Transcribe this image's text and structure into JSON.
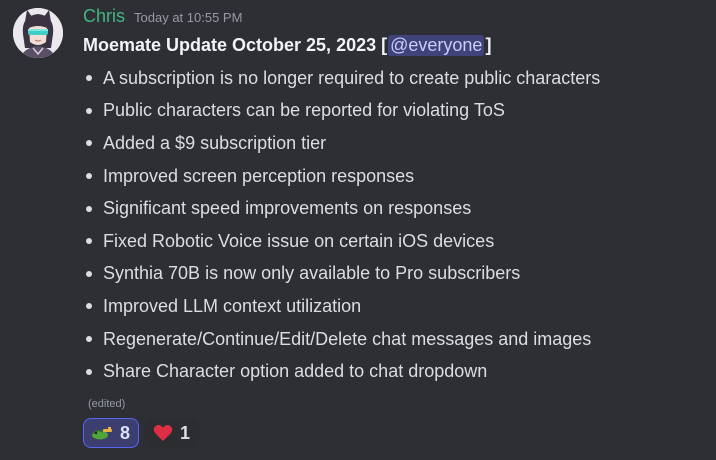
{
  "message": {
    "author": "Chris",
    "timestamp": "Today at 10:55 PM",
    "title_text": "Moemate Update October 25, 2023 ",
    "bracket_open": "[",
    "mention": "@everyone",
    "bracket_close": "]",
    "bullets": [
      "A subscription is no longer required to create public characters",
      "Public characters can be reported for violating ToS",
      "Added a $9 subscription tier",
      "Improved screen perception responses",
      "Significant speed improvements on responses",
      "Fixed Robotic Voice issue on certain iOS devices",
      "Synthia 70B is now only available to Pro subscribers",
      "Improved LLM context utilization",
      "Regenerate/Continue/Edit/Delete chat messages and images",
      "Share Character option added to chat dropdown"
    ],
    "edited_label": "(edited)"
  },
  "reactions": [
    {
      "emoji": "frog-icon",
      "count": "8",
      "active": true
    },
    {
      "emoji": "heart-icon",
      "count": "1",
      "active": false
    }
  ],
  "colors": {
    "background": "#2e2f34",
    "username": "#43b581",
    "mention_bg": "#40437a",
    "mention_text": "#c9cdfb",
    "reaction_active_border": "#5865f2"
  }
}
